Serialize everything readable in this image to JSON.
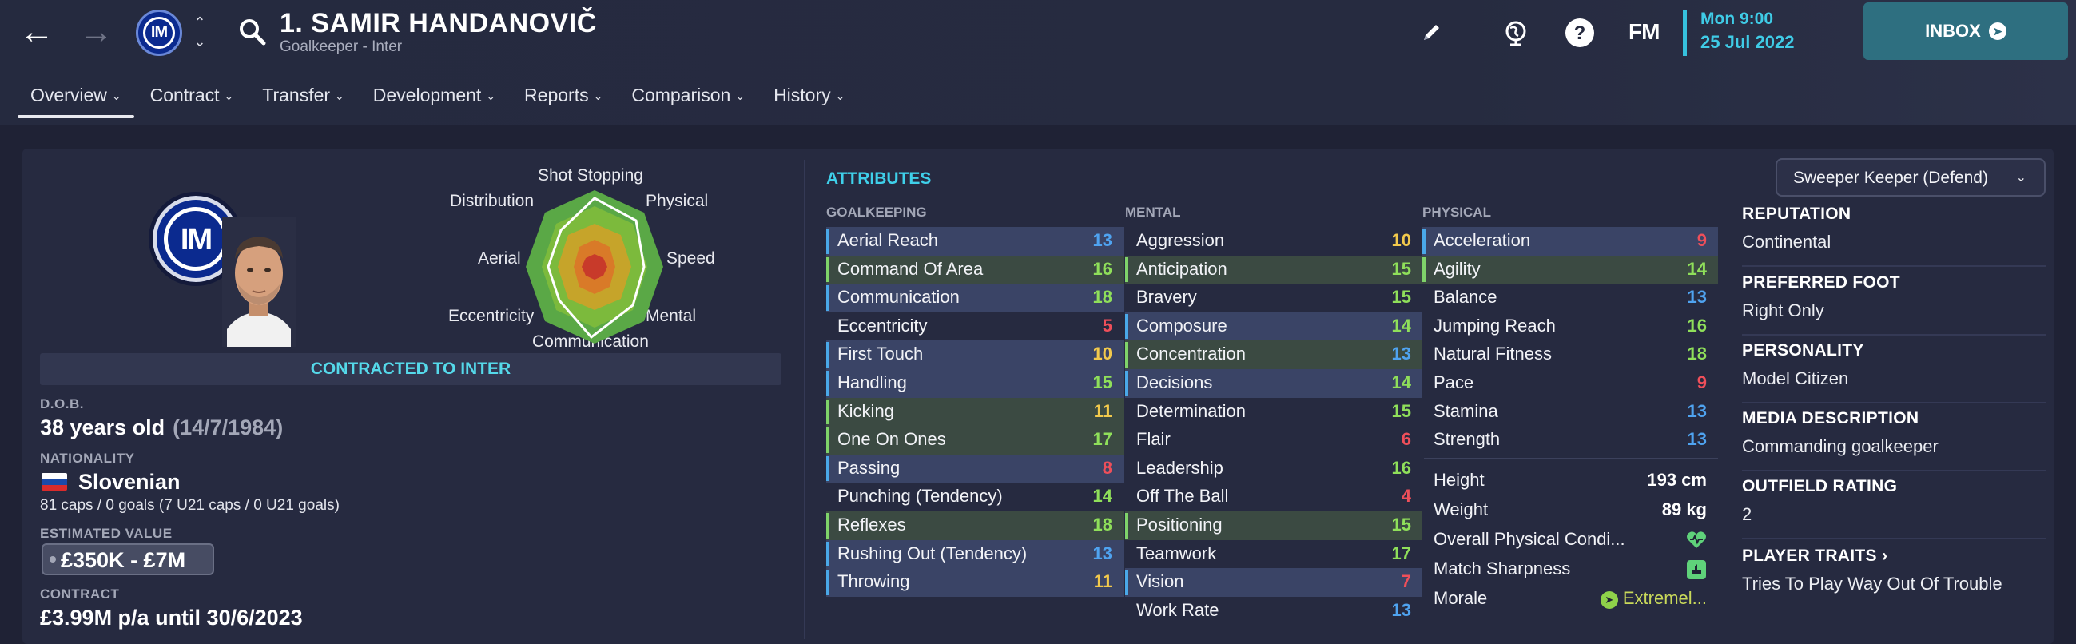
{
  "header": {
    "player_name": "1. SAMIR HANDANOVIČ",
    "player_subtitle": "Goalkeeper - Inter",
    "club_monogram": "IM",
    "date_time": "Mon 9:00",
    "date_day": "25 Jul 2022",
    "logo": "FM",
    "inbox_label": "INBOX",
    "icons": [
      "back-arrow-icon",
      "forward-arrow-icon",
      "club-badge-icon",
      "up-down-icon",
      "search-icon",
      "pencil-icon",
      "globe-icon",
      "help-icon"
    ]
  },
  "tabs": [
    {
      "label": "Overview",
      "active": true
    },
    {
      "label": "Contract"
    },
    {
      "label": "Transfer"
    },
    {
      "label": "Development"
    },
    {
      "label": "Reports"
    },
    {
      "label": "Comparison"
    },
    {
      "label": "History"
    }
  ],
  "radar": {
    "labels": {
      "shot_stopping": "Shot Stopping",
      "physical": "Physical",
      "speed": "Speed",
      "mental": "Mental",
      "communication": "Communication",
      "eccentricity": "Eccentricity",
      "aerial": "Aerial",
      "distribution": "Distribution"
    }
  },
  "overview": {
    "contracted_banner": "CONTRACTED TO INTER",
    "dob_label": "D.O.B.",
    "age": "38 years old",
    "dob": "(14/7/1984)",
    "nationality_label": "NATIONALITY",
    "nationality": "Slovenian",
    "caps": "81 caps / 0 goals (7 U21 caps / 0 U21 goals)",
    "value_label": "ESTIMATED VALUE",
    "value": "£350K - £7M",
    "contract_label": "CONTRACT",
    "contract": "£3.99M p/a until 30/6/2023"
  },
  "attributes": {
    "title": "ATTRIBUTES",
    "role_select": "Sweeper Keeper (Defend)",
    "goalkeeping": {
      "label": "GOALKEEPING",
      "rows": [
        {
          "name": "Aerial Reach",
          "value": "13",
          "hl": "blue",
          "key": true
        },
        {
          "name": "Command Of Area",
          "value": "16",
          "hl": "green",
          "key": true
        },
        {
          "name": "Communication",
          "value": "18",
          "hl": "blue",
          "key": true
        },
        {
          "name": "Eccentricity",
          "value": "5",
          "hl": "",
          "key": false
        },
        {
          "name": "First Touch",
          "value": "10",
          "hl": "blue",
          "key": true
        },
        {
          "name": "Handling",
          "value": "15",
          "hl": "blue",
          "key": true
        },
        {
          "name": "Kicking",
          "value": "11",
          "hl": "green",
          "key": true
        },
        {
          "name": "One On Ones",
          "value": "17",
          "hl": "green",
          "key": true
        },
        {
          "name": "Passing",
          "value": "8",
          "hl": "blue",
          "key": true
        },
        {
          "name": "Punching (Tendency)",
          "value": "14",
          "hl": "",
          "key": false
        },
        {
          "name": "Reflexes",
          "value": "18",
          "hl": "green",
          "key": true
        },
        {
          "name": "Rushing Out (Tendency)",
          "value": "13",
          "hl": "blue",
          "key": true
        },
        {
          "name": "Throwing",
          "value": "11",
          "hl": "blue",
          "key": true
        }
      ]
    },
    "mental": {
      "label": "MENTAL",
      "rows": [
        {
          "name": "Aggression",
          "value": "10",
          "hl": "",
          "key": false
        },
        {
          "name": "Anticipation",
          "value": "15",
          "hl": "green",
          "key": true
        },
        {
          "name": "Bravery",
          "value": "15",
          "hl": "",
          "key": false
        },
        {
          "name": "Composure",
          "value": "14",
          "hl": "blue",
          "key": true
        },
        {
          "name": "Concentration",
          "value": "13",
          "hl": "green",
          "key": true
        },
        {
          "name": "Decisions",
          "value": "14",
          "hl": "blue",
          "key": true
        },
        {
          "name": "Determination",
          "value": "15",
          "hl": "",
          "key": false
        },
        {
          "name": "Flair",
          "value": "6",
          "hl": "",
          "key": false
        },
        {
          "name": "Leadership",
          "value": "16",
          "hl": "",
          "key": false
        },
        {
          "name": "Off The Ball",
          "value": "4",
          "hl": "",
          "key": false
        },
        {
          "name": "Positioning",
          "value": "15",
          "hl": "green",
          "key": true
        },
        {
          "name": "Teamwork",
          "value": "17",
          "hl": "",
          "key": false
        },
        {
          "name": "Vision",
          "value": "7",
          "hl": "blue",
          "key": true
        },
        {
          "name": "Work Rate",
          "value": "13",
          "hl": "",
          "key": false
        }
      ]
    },
    "physical": {
      "label": "PHYSICAL",
      "rows": [
        {
          "name": "Acceleration",
          "value": "9",
          "hl": "blue",
          "key": true
        },
        {
          "name": "Agility",
          "value": "14",
          "hl": "green",
          "key": true
        },
        {
          "name": "Balance",
          "value": "13",
          "hl": "",
          "key": false
        },
        {
          "name": "Jumping Reach",
          "value": "16",
          "hl": "",
          "key": false
        },
        {
          "name": "Natural Fitness",
          "value": "18",
          "hl": "",
          "key": false
        },
        {
          "name": "Pace",
          "value": "9",
          "hl": "",
          "key": false
        },
        {
          "name": "Stamina",
          "value": "13",
          "hl": "",
          "key": false
        },
        {
          "name": "Strength",
          "value": "13",
          "hl": "",
          "key": false
        }
      ],
      "height_label": "Height",
      "height": "193 cm",
      "weight_label": "Weight",
      "weight": "89 kg",
      "condition_label": "Overall Physical Condi...",
      "sharpness_label": "Match Sharpness",
      "morale_label": "Morale",
      "morale": "Extremel..."
    }
  },
  "info": {
    "reputation_label": "REPUTATION",
    "reputation": "Continental",
    "foot_label": "PREFERRED FOOT",
    "foot": "Right Only",
    "personality_label": "PERSONALITY",
    "personality": "Model Citizen",
    "media_label": "MEDIA DESCRIPTION",
    "media": "Commanding goalkeeper",
    "outfield_label": "OUTFIELD RATING",
    "outfield": "2",
    "traits_label": "PLAYER TRAITS",
    "traits": "Tries To Play Way Out Of Trouble"
  },
  "colors": {
    "accent_cyan": "#3fd0ea",
    "attr_high": "#8fdf5a",
    "attr_good": "#4fa3f0",
    "attr_mid": "#f2c94c",
    "attr_low": "#ef4f5a"
  }
}
